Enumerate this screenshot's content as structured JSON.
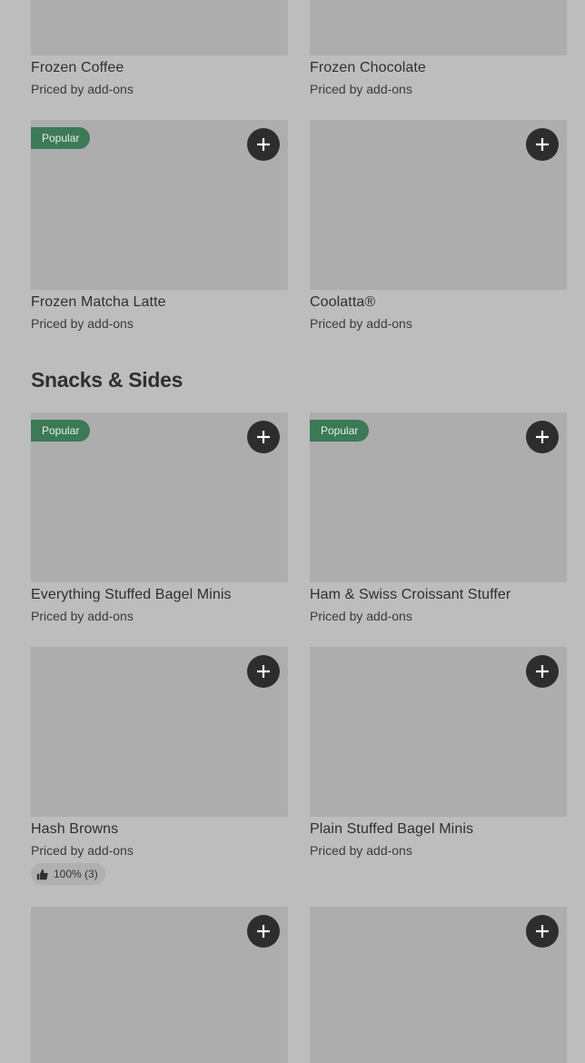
{
  "top_row": [
    {
      "name": "Frozen Coffee",
      "price": "Priced by add-ons"
    },
    {
      "name": "Frozen Chocolate",
      "price": "Priced by add-ons"
    }
  ],
  "row2": [
    {
      "name": "Frozen Matcha Latte",
      "price": "Priced by add-ons",
      "badge": "Popular"
    },
    {
      "name": "Coolatta®",
      "price": "Priced by add-ons"
    }
  ],
  "section": {
    "title": "Snacks & Sides"
  },
  "snacks_row1": [
    {
      "name": "Everything Stuffed Bagel Minis",
      "price": "Priced by add-ons",
      "badge": "Popular"
    },
    {
      "name": "Ham & Swiss Croissant Stuffer",
      "price": "Priced by add-ons",
      "badge": "Popular"
    }
  ],
  "snacks_row2": [
    {
      "name": "Hash Browns",
      "price": "Priced by add-ons",
      "rating": "100% (3)"
    },
    {
      "name": "Plain Stuffed Bagel Minis",
      "price": "Priced by add-ons"
    }
  ],
  "icons": {
    "add": "plus-icon",
    "rating": "thumbs-up-icon"
  },
  "colors": {
    "background": "#bdbdbd",
    "thumb": "#adadad",
    "badge": "#3c7a57",
    "add_button": "#2d2d2d"
  }
}
